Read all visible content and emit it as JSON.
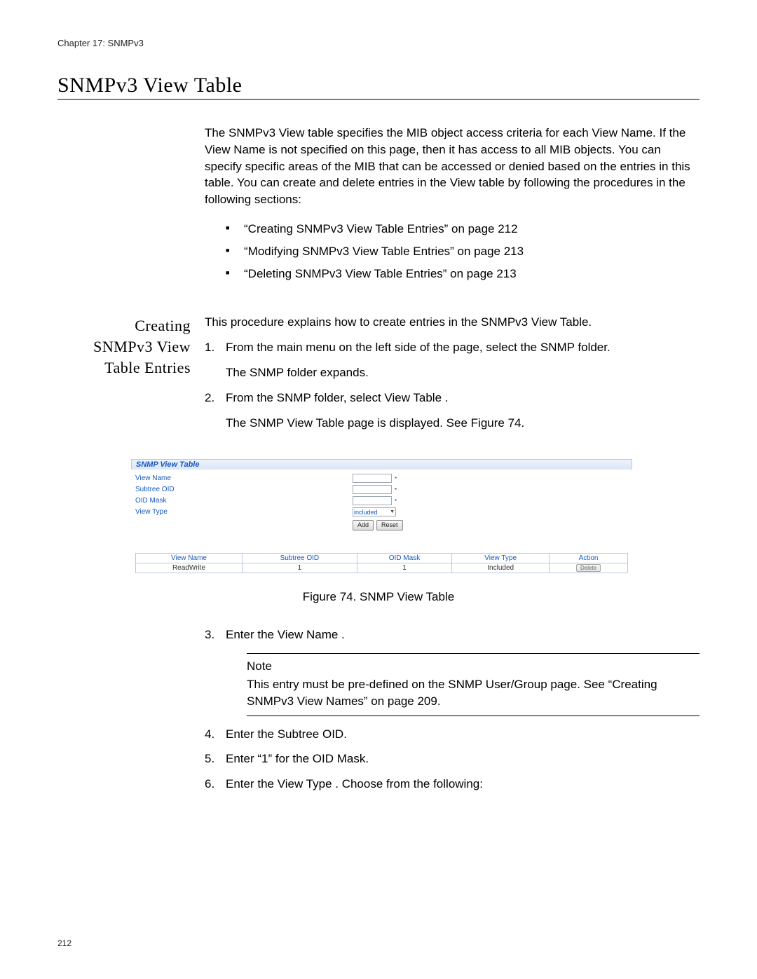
{
  "header": {
    "chapter": "Chapter 17: SNMPv3"
  },
  "title": "SNMPv3 View Table",
  "intro": {
    "p1": "The SNMPv3 View table specifies the MIB object access criteria for each View Name. If the View Name is not specified on this page, then it has access to all MIB objects. You can specify specific areas of the MIB that can be accessed or denied based on the entries in this table. You can create and delete entries in the View table by following the procedures in the following sections:",
    "bullets": [
      "“Creating SNMPv3 View Table Entries” on page 212",
      "“Modifying SNMPv3 View Table Entries” on page 213",
      "“Deleting SNMPv3 View Table Entries” on page 213"
    ]
  },
  "section": {
    "side_title_l1": "Creating",
    "side_title_l2": "SNMPv3 View",
    "side_title_l3": "Table Entries",
    "lead": "This procedure explains how to create entries in the SNMPv3 View Table.",
    "step1": "From the main menu on the left side of the page, select the SNMP folder.",
    "step1_after": "The SNMP folder expands.",
    "step2": "From the SNMP folder, select View Table .",
    "step2_after": "The SNMP View Table page is displayed. See Figure 74.",
    "step3": "Enter the View Name .",
    "note_heading": "Note",
    "note_body": "This entry must be pre-defined on the SNMP User/Group page. See “Creating SNMPv3 View Names” on page 209.",
    "step4": "Enter the Subtree OID.",
    "step5": "Enter “1” for the OID Mask.",
    "step6": "Enter the View Type . Choose from the following:"
  },
  "figure": {
    "panel_title": "SNMP View Table",
    "labels": {
      "view_name": "View Name",
      "subtree_oid": "Subtree OID",
      "oid_mask": "OID Mask",
      "view_type": "View Type"
    },
    "select_value": "included",
    "buttons": {
      "add": "Add",
      "reset": "Reset"
    },
    "columns": [
      "View Name",
      "Subtree OID",
      "OID Mask",
      "View Type",
      "Action"
    ],
    "row": {
      "view_name": "ReadWrite",
      "subtree_oid": "1",
      "oid_mask": "1",
      "view_type": "Included",
      "action_label": "Delete"
    },
    "caption": "Figure 74. SNMP View Table"
  },
  "page_number": "212"
}
